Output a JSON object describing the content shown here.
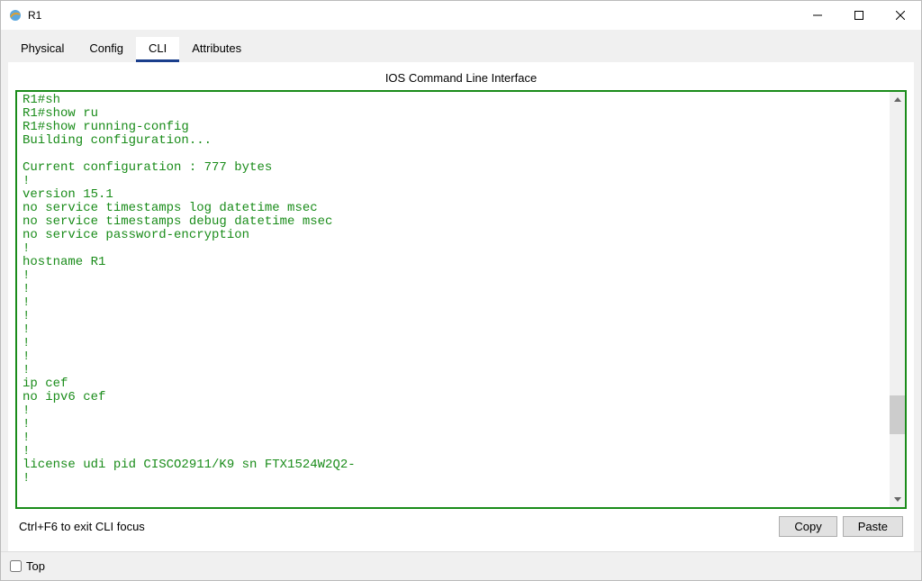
{
  "window": {
    "title": "R1"
  },
  "tabs": {
    "physical": "Physical",
    "config": "Config",
    "cli": "CLI",
    "attributes": "Attributes"
  },
  "panel": {
    "title": "IOS Command Line Interface",
    "terminal_output": "R1#sh\nR1#show ru\nR1#show running-config \nBuilding configuration...\n\nCurrent configuration : 777 bytes\n!\nversion 15.1\nno service timestamps log datetime msec\nno service timestamps debug datetime msec\nno service password-encryption\n!\nhostname R1\n!\n!\n!\n!\n!\n!\n!\n!\nip cef\nno ipv6 cef\n!\n!\n!\n!\nlicense udi pid CISCO2911/K9 sn FTX1524W2Q2-\n!"
  },
  "footer": {
    "hint": "Ctrl+F6 to exit CLI focus",
    "copy": "Copy",
    "paste": "Paste"
  },
  "statusbar": {
    "top_label": "Top"
  }
}
